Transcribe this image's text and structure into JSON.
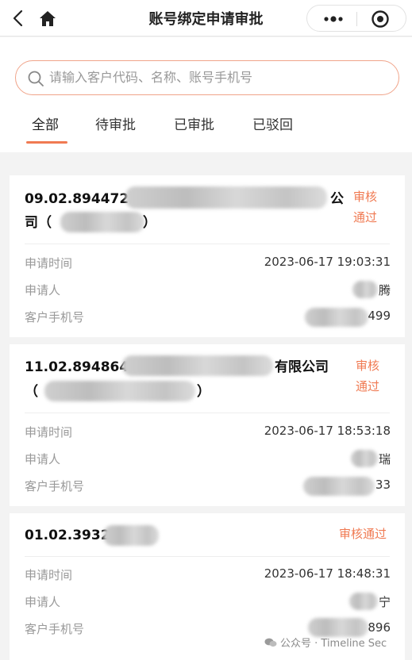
{
  "header": {
    "title": "账号绑定申请审批"
  },
  "search": {
    "placeholder": "请输入客户代码、名称、账号手机号"
  },
  "tabs": [
    {
      "label": "全部",
      "active": true
    },
    {
      "label": "待审批",
      "active": false
    },
    {
      "label": "已审批",
      "active": false
    },
    {
      "label": "已驳回",
      "active": false
    }
  ],
  "labels": {
    "time": "申请时间",
    "applicant": "申请人",
    "phone": "客户手机号"
  },
  "records": [
    {
      "code": "09.02.894472",
      "title_tail": "公",
      "title_line2_start": "司（",
      "title_line2_end": "）",
      "status_line1": "审核",
      "status_line2": "通过",
      "time": "2023-06-17 19:03:31",
      "applicant": "腾",
      "phone": "499"
    },
    {
      "code": "11.02.894864",
      "title_tail": "有限公司",
      "title_line2_start": "（",
      "title_line2_end": "）",
      "status_line1": "审核",
      "status_line2": "通过",
      "time": "2023-06-17 18:53:18",
      "applicant": "瑞",
      "phone": "33"
    },
    {
      "code": "01.02.3932",
      "status": "审核通过",
      "time": "2023-06-17 18:48:31",
      "applicant": "宁",
      "phone": "896"
    }
  ],
  "watermark": "公众号 · Timeline Sec",
  "colors": {
    "accent": "#f07a52",
    "background": "#f3f3f3"
  }
}
